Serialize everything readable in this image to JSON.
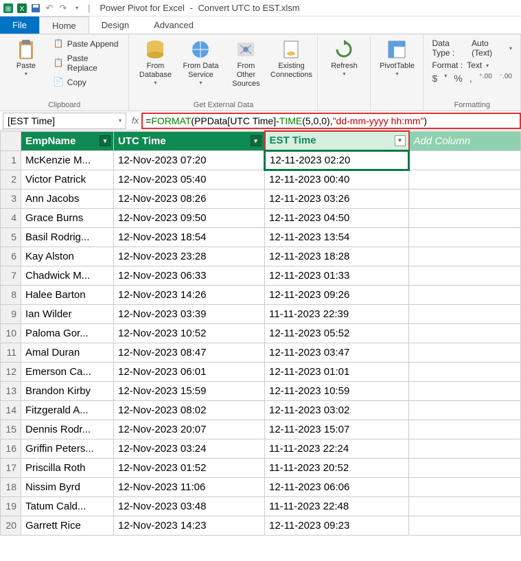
{
  "titlebar": {
    "app": "Power Pivot for Excel",
    "file": "Convert UTC to EST.xlsm",
    "sep": "-"
  },
  "tabs": {
    "file": "File",
    "home": "Home",
    "design": "Design",
    "advanced": "Advanced"
  },
  "ribbon": {
    "clipboard": {
      "label": "Clipboard",
      "paste": "Paste",
      "append": "Paste Append",
      "replace": "Paste Replace",
      "copy": "Copy"
    },
    "getdata": {
      "label": "Get External Data",
      "db": "From Database",
      "svc": "From Data Service",
      "other": "From Other Sources",
      "existing": "Existing Connections"
    },
    "refresh": "Refresh",
    "pivot": "PivotTable",
    "formatting": {
      "label": "Formatting",
      "datatype_lbl": "Data Type :",
      "datatype_val": "Auto (Text)",
      "format_lbl": "Format :",
      "format_val": "Text",
      "currency": "$",
      "percent": "%",
      "comma": ",",
      "dec_inc": ".00→.0",
      "dec_dec": ".0→.00"
    }
  },
  "namebox": "[EST Time]",
  "formula": {
    "eq": "=",
    "fn1": "FORMAT",
    "open1": "(",
    "ref1": "PPData[UTC Time]",
    "minus": "-",
    "fn2": "TIME",
    "args2": "(5,0,0)",
    "comma": ",",
    "str": "\"dd-mm-yyyy hh:mm\"",
    "close": ")"
  },
  "headers": {
    "emp": "EmpName",
    "utc": "UTC Time",
    "est": "EST Time",
    "add": "Add Column"
  },
  "rows": [
    {
      "n": "1",
      "emp": "McKenzie M...",
      "utc": "12-Nov-2023 07:20",
      "est": "12-11-2023 02:20"
    },
    {
      "n": "2",
      "emp": "Victor Patrick",
      "utc": "12-Nov-2023 05:40",
      "est": "12-11-2023 00:40"
    },
    {
      "n": "3",
      "emp": "Ann Jacobs",
      "utc": "12-Nov-2023 08:26",
      "est": "12-11-2023 03:26"
    },
    {
      "n": "4",
      "emp": "Grace Burns",
      "utc": "12-Nov-2023 09:50",
      "est": "12-11-2023 04:50"
    },
    {
      "n": "5",
      "emp": "Basil Rodrig...",
      "utc": "12-Nov-2023 18:54",
      "est": "12-11-2023 13:54"
    },
    {
      "n": "6",
      "emp": "Kay Alston",
      "utc": "12-Nov-2023 23:28",
      "est": "12-11-2023 18:28"
    },
    {
      "n": "7",
      "emp": "Chadwick M...",
      "utc": "12-Nov-2023 06:33",
      "est": "12-11-2023 01:33"
    },
    {
      "n": "8",
      "emp": "Halee Barton",
      "utc": "12-Nov-2023 14:26",
      "est": "12-11-2023 09:26"
    },
    {
      "n": "9",
      "emp": "Ian Wilder",
      "utc": "12-Nov-2023 03:39",
      "est": "11-11-2023 22:39"
    },
    {
      "n": "10",
      "emp": "Paloma Gor...",
      "utc": "12-Nov-2023 10:52",
      "est": "12-11-2023 05:52"
    },
    {
      "n": "11",
      "emp": "Amal Duran",
      "utc": "12-Nov-2023 08:47",
      "est": "12-11-2023 03:47"
    },
    {
      "n": "12",
      "emp": "Emerson Ca...",
      "utc": "12-Nov-2023 06:01",
      "est": "12-11-2023 01:01"
    },
    {
      "n": "13",
      "emp": "Brandon Kirby",
      "utc": "12-Nov-2023 15:59",
      "est": "12-11-2023 10:59"
    },
    {
      "n": "14",
      "emp": "Fitzgerald A...",
      "utc": "12-Nov-2023 08:02",
      "est": "12-11-2023 03:02"
    },
    {
      "n": "15",
      "emp": "Dennis Rodr...",
      "utc": "12-Nov-2023 20:07",
      "est": "12-11-2023 15:07"
    },
    {
      "n": "16",
      "emp": "Griffin Peters...",
      "utc": "12-Nov-2023 03:24",
      "est": "11-11-2023 22:24"
    },
    {
      "n": "17",
      "emp": "Priscilla Roth",
      "utc": "12-Nov-2023 01:52",
      "est": "11-11-2023 20:52"
    },
    {
      "n": "18",
      "emp": "Nissim Byrd",
      "utc": "12-Nov-2023 11:06",
      "est": "12-11-2023 06:06"
    },
    {
      "n": "19",
      "emp": "Tatum Cald...",
      "utc": "12-Nov-2023 03:48",
      "est": "11-11-2023 22:48"
    },
    {
      "n": "20",
      "emp": "Garrett Rice",
      "utc": "12-Nov-2023 14:23",
      "est": "12-11-2023 09:23"
    }
  ]
}
